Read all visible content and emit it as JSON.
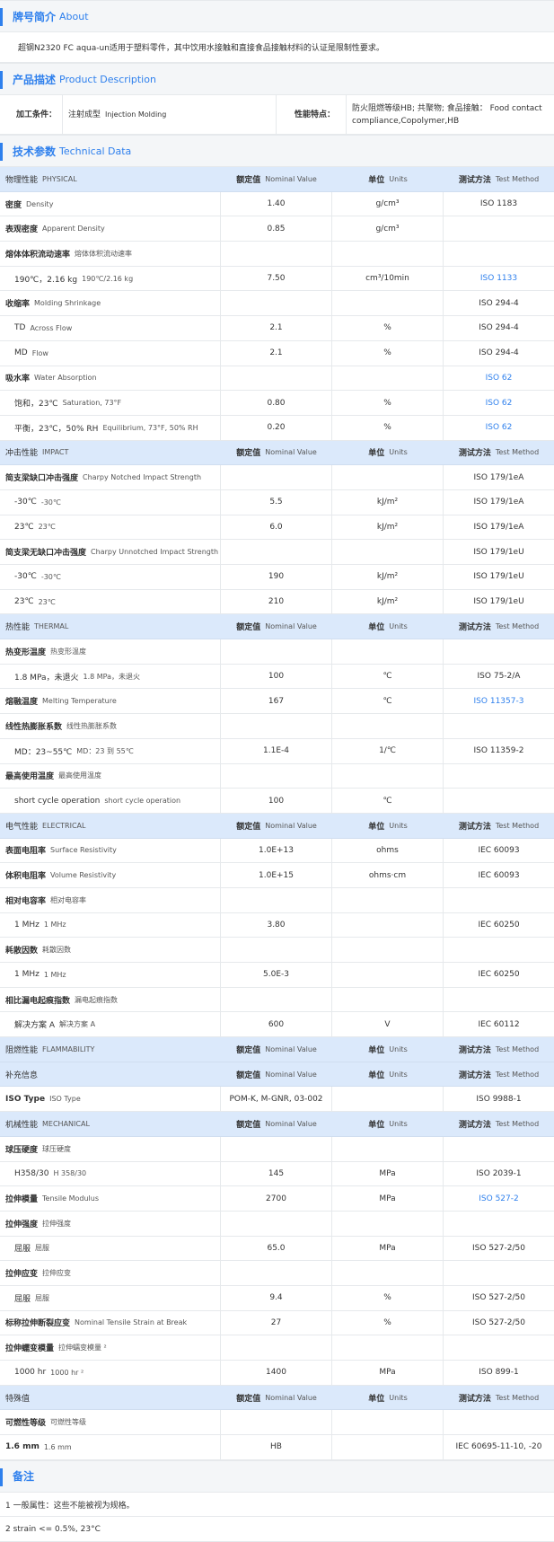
{
  "brand": {
    "title": "牌号简介",
    "title_en": "About",
    "text": "超钢N2320 FC aqua-un适用于塑料零件，其中饮用水接触和直接食品接触材料的认证是限制性要求。"
  },
  "description": {
    "title": "产品描述",
    "title_en": "Product Description",
    "label1": "加工条件：",
    "value1_cn": "注射成型",
    "value1_en": "Injection Molding",
    "label2": "性能特点：",
    "value2": "防火阻燃等级HB; 共聚物; 食品接触：  Food contact compliance,Copolymer,HB"
  },
  "technical": {
    "title": "技术参数",
    "title_en": "Technical Data",
    "rows": [
      {
        "t": "h",
        "a": "物理性能",
        "ae": "PHYSICAL",
        "b": "额定值",
        "be": "Nominal Value",
        "c": "单位",
        "ce": "Units",
        "d": "测试方法",
        "de": "Test Method"
      },
      {
        "t": "m",
        "a": "密度",
        "ae": "Density",
        "b": "1.40",
        "c": "g/cm³",
        "d": "ISO 1183"
      },
      {
        "t": "m",
        "a": "表观密度",
        "ae": "Apparent Density",
        "b": "0.85",
        "c": "g/cm³",
        "d": ""
      },
      {
        "t": "m",
        "a": "熔体体积流动速率",
        "ae": "熔体体积流动速率",
        "b": "",
        "c": "",
        "d": ""
      },
      {
        "t": "s",
        "a": "190℃，2.16 kg",
        "ae": "190℃/2.16 kg",
        "b": "7.50",
        "c": "cm³/10min",
        "d": "ISO 1133",
        "dl": true
      },
      {
        "t": "m",
        "a": "收缩率",
        "ae": "Molding Shrinkage",
        "b": "",
        "c": "",
        "d": "ISO 294-4"
      },
      {
        "t": "s",
        "a": "TD",
        "ae": "Across Flow",
        "b": "2.1",
        "c": "%",
        "d": "ISO 294-4"
      },
      {
        "t": "s",
        "a": "MD",
        "ae": "Flow",
        "b": "2.1",
        "c": "%",
        "d": "ISO 294-4"
      },
      {
        "t": "m",
        "a": "吸水率",
        "ae": "Water Absorption",
        "b": "",
        "c": "",
        "d": "ISO 62",
        "dl": true
      },
      {
        "t": "s",
        "a": "饱和，23℃",
        "ae": "Saturation, 73°F",
        "b": "0.80",
        "c": "%",
        "d": "ISO 62",
        "dl": true
      },
      {
        "t": "s",
        "a": "平衡，23℃，50% RH",
        "ae": "Equilibrium, 73°F, 50% RH",
        "b": "0.20",
        "c": "%",
        "d": "ISO 62",
        "dl": true
      },
      {
        "t": "h",
        "a": "冲击性能",
        "ae": "IMPACT",
        "b": "额定值",
        "be": "Nominal Value",
        "c": "单位",
        "ce": "Units",
        "d": "测试方法",
        "de": "Test Method"
      },
      {
        "t": "m",
        "a": "简支梁缺口冲击强度",
        "ae": "Charpy Notched Impact Strength",
        "b": "",
        "c": "",
        "d": "ISO 179/1eA"
      },
      {
        "t": "s",
        "a": "-30℃",
        "ae": "-30℃",
        "b": "5.5",
        "c": "kJ/m²",
        "d": "ISO 179/1eA"
      },
      {
        "t": "s",
        "a": "23℃",
        "ae": "23℃",
        "b": "6.0",
        "c": "kJ/m²",
        "d": "ISO 179/1eA"
      },
      {
        "t": "m",
        "a": "简支梁无缺口冲击强度",
        "ae": "Charpy Unnotched Impact Strength",
        "b": "",
        "c": "",
        "d": "ISO 179/1eU"
      },
      {
        "t": "s",
        "a": "-30℃",
        "ae": "-30℃",
        "b": "190",
        "c": "kJ/m²",
        "d": "ISO 179/1eU"
      },
      {
        "t": "s",
        "a": "23℃",
        "ae": "23℃",
        "b": "210",
        "c": "kJ/m²",
        "d": "ISO 179/1eU"
      },
      {
        "t": "h",
        "a": "热性能",
        "ae": "THERMAL",
        "b": "额定值",
        "be": "Nominal Value",
        "c": "单位",
        "ce": "Units",
        "d": "测试方法",
        "de": "Test Method"
      },
      {
        "t": "m",
        "a": "热变形温度",
        "ae": "热变形温度",
        "b": "",
        "c": "",
        "d": ""
      },
      {
        "t": "s",
        "a": "1.8 MPa，未退火",
        "ae": "1.8 MPa，未退火",
        "b": "100",
        "c": "℃",
        "d": "ISO 75-2/A"
      },
      {
        "t": "m",
        "a": "熔融温度",
        "ae": "Melting Temperature",
        "b": "167",
        "c": "℃",
        "d": "ISO 11357-3",
        "dl": true
      },
      {
        "t": "m",
        "a": "线性热膨胀系数",
        "ae": "线性热膨胀系数",
        "b": "",
        "c": "",
        "d": ""
      },
      {
        "t": "s",
        "a": "MD：23~55℃",
        "ae": "MD：23 到 55℃",
        "b": "1.1E-4",
        "c": "1/℃",
        "d": "ISO 11359-2"
      },
      {
        "t": "m",
        "a": "最高使用温度",
        "ae": "最高使用温度",
        "b": "",
        "c": "",
        "d": ""
      },
      {
        "t": "s",
        "a": "short cycle operation",
        "ae": "short cycle operation",
        "b": "100",
        "c": "℃",
        "d": ""
      },
      {
        "t": "h",
        "a": "电气性能",
        "ae": "ELECTRICAL",
        "b": "额定值",
        "be": "Nominal Value",
        "c": "单位",
        "ce": "Units",
        "d": "测试方法",
        "de": "Test Method"
      },
      {
        "t": "m",
        "a": "表面电阻率",
        "ae": "Surface Resistivity",
        "b": "1.0E+13",
        "c": "ohms",
        "d": "IEC 60093"
      },
      {
        "t": "m",
        "a": "体积电阻率",
        "ae": "Volume Resistivity",
        "b": "1.0E+15",
        "c": "ohms·cm",
        "d": "IEC 60093"
      },
      {
        "t": "m",
        "a": "相对电容率",
        "ae": "相对电容率",
        "b": "",
        "c": "",
        "d": ""
      },
      {
        "t": "s",
        "a": "1 MHz",
        "ae": "1 MHz",
        "b": "3.80",
        "c": "",
        "d": "IEC 60250"
      },
      {
        "t": "m",
        "a": "耗散因数",
        "ae": "耗散因数",
        "b": "",
        "c": "",
        "d": ""
      },
      {
        "t": "s",
        "a": "1 MHz",
        "ae": "1 MHz",
        "b": "5.0E-3",
        "c": "",
        "d": "IEC 60250"
      },
      {
        "t": "m",
        "a": "相比漏电起痕指数",
        "ae": "漏电起痕指数",
        "b": "",
        "c": "",
        "d": ""
      },
      {
        "t": "s",
        "a": "解决方案 A",
        "ae": "解决方案 A",
        "b": "600",
        "c": "V",
        "d": "IEC 60112"
      },
      {
        "t": "h",
        "a": "阻燃性能",
        "ae": "FLAMMABILITY",
        "b": "额定值",
        "be": "Nominal Value",
        "c": "单位",
        "ce": "Units",
        "d": "测试方法",
        "de": "Test Method"
      },
      {
        "t": "h",
        "a": "补充信息",
        "ae": "",
        "b": "额定值",
        "be": "Nominal Value",
        "c": "单位",
        "ce": "Units",
        "d": "测试方法",
        "de": "Test Method"
      },
      {
        "t": "m",
        "a": "ISO Type",
        "ae": "ISO Type",
        "b": "POM-K, M-GNR, 03-002",
        "c": "",
        "d": "ISO 9988-1"
      },
      {
        "t": "h",
        "a": "机械性能",
        "ae": "MECHANICAL",
        "b": "额定值",
        "be": "Nominal Value",
        "c": "单位",
        "ce": "Units",
        "d": "测试方法",
        "de": "Test Method"
      },
      {
        "t": "m",
        "a": "球压硬度",
        "ae": "球压硬度",
        "b": "",
        "c": "",
        "d": ""
      },
      {
        "t": "s",
        "a": "H358/30",
        "ae": "H 358/30",
        "b": "145",
        "c": "MPa",
        "d": "ISO 2039-1"
      },
      {
        "t": "m",
        "a": "拉伸模量",
        "ae": "Tensile Modulus",
        "b": "2700",
        "c": "MPa",
        "d": "ISO 527-2",
        "dl": true
      },
      {
        "t": "m",
        "a": "拉伸强度",
        "ae": "拉伸强度",
        "b": "",
        "c": "",
        "d": ""
      },
      {
        "t": "s",
        "a": "屈服",
        "ae": "屈服",
        "b": "65.0",
        "c": "MPa",
        "d": "ISO 527-2/50"
      },
      {
        "t": "m",
        "a": "拉伸应变",
        "ae": "拉伸应变",
        "b": "",
        "c": "",
        "d": ""
      },
      {
        "t": "s",
        "a": "屈服",
        "ae": "屈服",
        "b": "9.4",
        "c": "%",
        "d": "ISO 527-2/50"
      },
      {
        "t": "m",
        "a": "标称拉伸断裂应变",
        "ae": "Nominal Tensile Strain at Break",
        "b": "27",
        "c": "%",
        "d": "ISO 527-2/50"
      },
      {
        "t": "m",
        "a": "拉伸蠕变模量",
        "ae": "拉伸蠕变模量 ²",
        "b": "",
        "c": "",
        "d": ""
      },
      {
        "t": "s",
        "a": "1000 hr",
        "ae": "1000 hr ²",
        "b": "1400",
        "c": "MPa",
        "d": "ISO 899-1"
      },
      {
        "t": "h",
        "a": "特殊值",
        "ae": "",
        "b": "额定值",
        "be": "Nominal Value",
        "c": "单位",
        "ce": "Units",
        "d": "测试方法",
        "de": "Test Method"
      },
      {
        "t": "m",
        "a": "可燃性等级",
        "ae": "可燃性等级",
        "b": "",
        "c": "",
        "d": ""
      },
      {
        "t": "m",
        "a": "1.6 mm",
        "ae": "1.6 mm",
        "b": "HB",
        "c": "",
        "d": "IEC 60695-11-10, -20"
      }
    ]
  },
  "notes": {
    "title": "备注",
    "items": [
      "1 一般属性：这些不能被视为规格。",
      "2 strain <= 0.5%, 23°C"
    ]
  }
}
